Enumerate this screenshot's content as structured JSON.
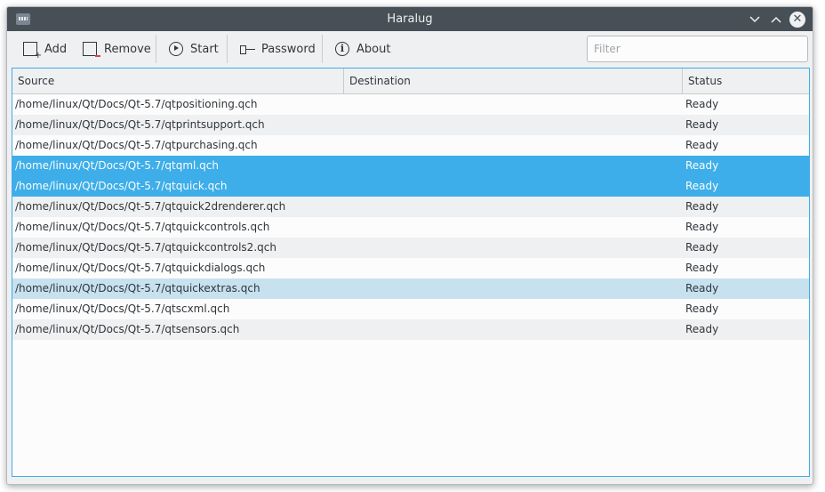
{
  "window": {
    "title": "Haralug"
  },
  "titlebar": {
    "minimize_glyph": "⌄",
    "maximize_glyph": "⌃",
    "close_glyph": "✕"
  },
  "toolbar": {
    "add_label": "Add",
    "remove_label": "Remove",
    "start_label": "Start",
    "password_label": "Password",
    "about_label": "About",
    "filter_placeholder": "Filter",
    "filter_value": ""
  },
  "table": {
    "columns": [
      "Source",
      "Destination",
      "Status"
    ],
    "rows": [
      {
        "source": "/home/linux/Qt/Docs/Qt-5.7/qtpositioning.qch",
        "destination": "",
        "status": "Ready",
        "state": "normal"
      },
      {
        "source": "/home/linux/Qt/Docs/Qt-5.7/qtprintsupport.qch",
        "destination": "",
        "status": "Ready",
        "state": "normal"
      },
      {
        "source": "/home/linux/Qt/Docs/Qt-5.7/qtpurchasing.qch",
        "destination": "",
        "status": "Ready",
        "state": "normal"
      },
      {
        "source": "/home/linux/Qt/Docs/Qt-5.7/qtqml.qch",
        "destination": "",
        "status": "Ready",
        "state": "selected"
      },
      {
        "source": "/home/linux/Qt/Docs/Qt-5.7/qtquick.qch",
        "destination": "",
        "status": "Ready",
        "state": "selected"
      },
      {
        "source": "/home/linux/Qt/Docs/Qt-5.7/qtquick2drenderer.qch",
        "destination": "",
        "status": "Ready",
        "state": "normal"
      },
      {
        "source": "/home/linux/Qt/Docs/Qt-5.7/qtquickcontrols.qch",
        "destination": "",
        "status": "Ready",
        "state": "normal"
      },
      {
        "source": "/home/linux/Qt/Docs/Qt-5.7/qtquickcontrols2.qch",
        "destination": "",
        "status": "Ready",
        "state": "normal"
      },
      {
        "source": "/home/linux/Qt/Docs/Qt-5.7/qtquickdialogs.qch",
        "destination": "",
        "status": "Ready",
        "state": "normal"
      },
      {
        "source": "/home/linux/Qt/Docs/Qt-5.7/qtquickextras.qch",
        "destination": "",
        "status": "Ready",
        "state": "hover"
      },
      {
        "source": "/home/linux/Qt/Docs/Qt-5.7/qtscxml.qch",
        "destination": "",
        "status": "Ready",
        "state": "normal"
      },
      {
        "source": "/home/linux/Qt/Docs/Qt-5.7/qtsensors.qch",
        "destination": "",
        "status": "Ready",
        "state": "normal"
      }
    ]
  },
  "colors": {
    "titlebar_bg": "#475057",
    "selection": "#3daee9",
    "hover": "#c7e1ef",
    "window_bg": "#eff0f1"
  },
  "icons": {
    "add": "add-document-icon",
    "remove": "remove-document-icon",
    "start": "play-circle-icon",
    "password": "key-icon",
    "about": "info-icon"
  }
}
